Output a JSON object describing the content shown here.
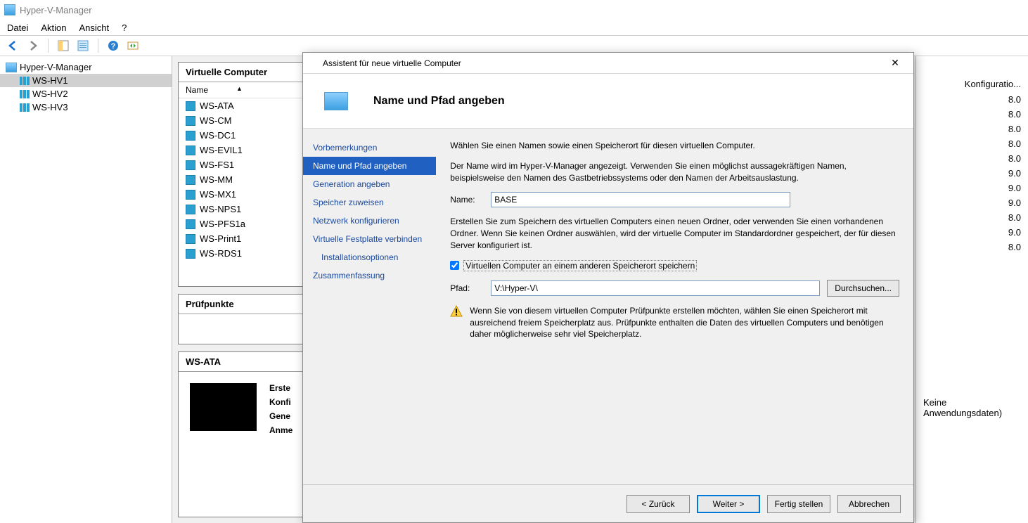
{
  "app": {
    "title": "Hyper-V-Manager"
  },
  "menu": {
    "file": "Datei",
    "action": "Aktion",
    "view": "Ansicht",
    "help": "?"
  },
  "tree": {
    "root": "Hyper-V-Manager",
    "servers": [
      "WS-HV1",
      "WS-HV2",
      "WS-HV3"
    ]
  },
  "vmpanel": {
    "title": "Virtuelle Computer",
    "col_name": "Name",
    "rows": [
      "WS-ATA",
      "WS-CM",
      "WS-DC1",
      "WS-EVIL1",
      "WS-FS1",
      "WS-MM",
      "WS-MX1",
      "WS-NPS1",
      "WS-PFS1a",
      "WS-Print1",
      "WS-RDS1"
    ]
  },
  "checkpoints": {
    "title": "Prüfpunkte"
  },
  "details": {
    "title": "WS-ATA",
    "labels": [
      "Erste",
      "Konfi",
      "Gene",
      "Anme"
    ]
  },
  "rightcol": {
    "header": "Konfiguratio...",
    "values": [
      "8.0",
      "8.0",
      "8.0",
      "8.0",
      "8.0",
      "9.0",
      "9.0",
      "9.0",
      "8.0",
      "9.0",
      "8.0"
    ],
    "footer": "Keine Anwendungsdaten)"
  },
  "wizard": {
    "window_title": "Assistent für neue virtuelle Computer",
    "page_title": "Name und Pfad angeben",
    "steps": [
      "Vorbemerkungen",
      "Name und Pfad angeben",
      "Generation angeben",
      "Speicher zuweisen",
      "Netzwerk konfigurieren",
      "Virtuelle Festplatte verbinden",
      "Installationsoptionen",
      "Zusammenfassung"
    ],
    "intro1": "Wählen Sie einen Namen sowie einen Speicherort für diesen virtuellen Computer.",
    "intro2": "Der Name wird im Hyper-V-Manager angezeigt. Verwenden Sie einen möglichst aussagekräftigen Namen, beispielsweise den Namen des Gastbetriebssystems oder den Namen der Arbeitsauslastung.",
    "name_label": "Name:",
    "name_value": "BASE",
    "storage_text": "Erstellen Sie zum Speichern des virtuellen Computers einen neuen Ordner, oder verwenden Sie einen vorhandenen Ordner. Wenn Sie keinen Ordner auswählen, wird der virtuelle Computer im Standardordner gespeichert, der für diesen Server konfiguriert ist.",
    "checkbox_label": "Virtuellen Computer an einem anderen Speicherort speichern",
    "path_label": "Pfad:",
    "path_value": "V:\\Hyper-V\\",
    "browse": "Durchsuchen...",
    "warning": "Wenn Sie von diesem virtuellen Computer Prüfpunkte erstellen möchten, wählen Sie einen Speicherort mit ausreichend freiem Speicherplatz aus. Prüfpunkte enthalten die Daten des virtuellen Computers und benötigen daher möglicherweise sehr viel Speicherplatz.",
    "buttons": {
      "back": "< Zurück",
      "next": "Weiter >",
      "finish": "Fertig stellen",
      "cancel": "Abbrechen"
    }
  }
}
